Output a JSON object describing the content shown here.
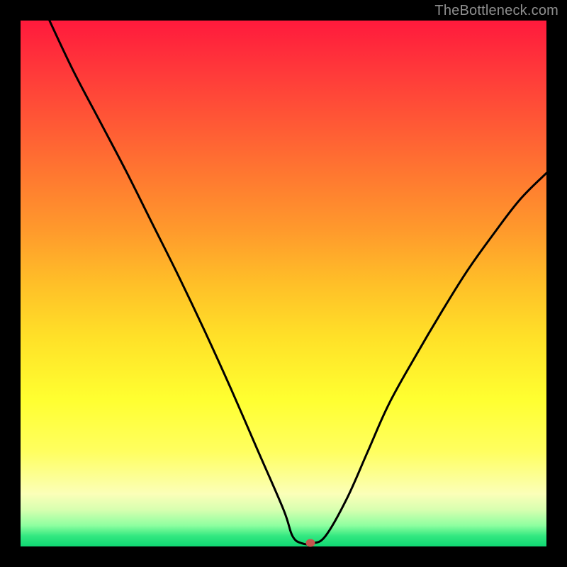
{
  "watermark": "TheBottleneck.com",
  "marker": {
    "x_frac": 0.551,
    "y_frac": 0.993
  },
  "chart_data": {
    "type": "line",
    "title": "",
    "xlabel": "",
    "ylabel": "",
    "xlim": [
      0,
      1
    ],
    "ylim": [
      0,
      1
    ],
    "series": [
      {
        "name": "bottleneck-curve",
        "x": [
          0.055,
          0.1,
          0.15,
          0.2,
          0.25,
          0.3,
          0.35,
          0.4,
          0.45,
          0.5,
          0.517,
          0.535,
          0.555,
          0.58,
          0.62,
          0.66,
          0.7,
          0.75,
          0.8,
          0.85,
          0.9,
          0.95,
          1.0
        ],
        "y": [
          1.0,
          0.905,
          0.81,
          0.715,
          0.615,
          0.515,
          0.41,
          0.3,
          0.185,
          0.07,
          0.02,
          0.006,
          0.006,
          0.02,
          0.09,
          0.18,
          0.27,
          0.36,
          0.445,
          0.525,
          0.595,
          0.66,
          0.71
        ]
      }
    ],
    "marker_point": {
      "x": 0.551,
      "y": 0.007,
      "color": "#c5564e"
    },
    "background_gradient": {
      "top": "#ff1a3c",
      "mid": "#ffe028",
      "bottom": "#0fd873"
    }
  }
}
